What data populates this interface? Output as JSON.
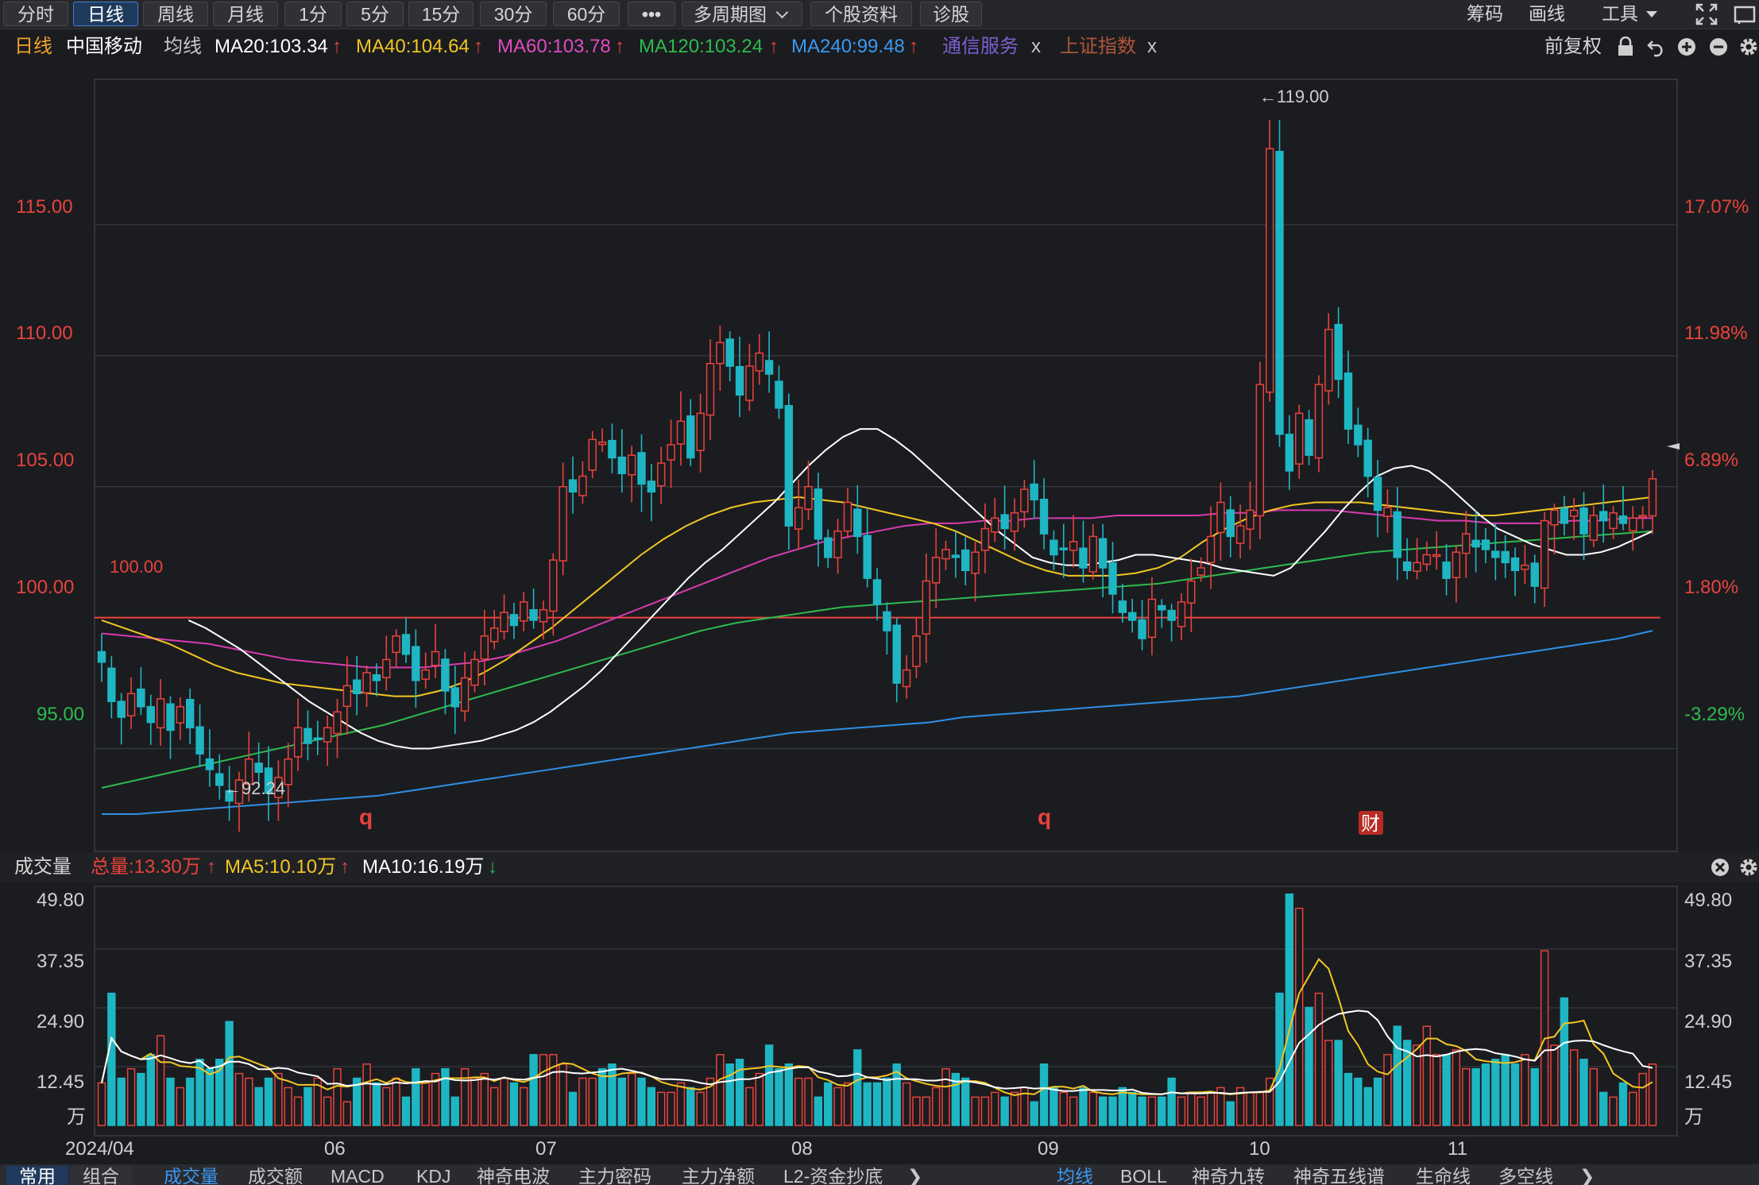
{
  "toolbar": {
    "period_tabs": [
      "分时",
      "日线",
      "周线",
      "月线",
      "1分",
      "5分",
      "15分",
      "30分",
      "60分"
    ],
    "active_tab": "日线",
    "more_label": "•••",
    "multi_period": "多周期图",
    "stock_info": "个股资料",
    "diagnose": "诊股",
    "right": {
      "chips": "筹码",
      "draw": "画线",
      "tools": "工具"
    }
  },
  "ma_bar": {
    "period": "日线",
    "stock_name": "中国移动",
    "ma_label": "均线",
    "ma20": "MA20:103.34",
    "ma40": "MA40:104.64",
    "ma60": "MA60:103.78",
    "ma120": "MA120:103.24",
    "ma240": "MA240:99.48",
    "overlay1": "通信服务",
    "overlay2": "上证指数",
    "close_mark": "x",
    "adjust": "前复权"
  },
  "colors": {
    "up": "#e8433c",
    "down": "#1fb6c4",
    "ma20": "#ffffff",
    "ma40": "#f2c623",
    "ma60": "#d83bb0",
    "ma120": "#2dbb4e",
    "ma240": "#2f8fe6",
    "grid": "#33353b"
  },
  "price_axis": {
    "left_ticks": [
      "115.00",
      "110.00",
      "105.00",
      "100.00",
      "95.00"
    ],
    "right_ticks": [
      "17.07%",
      "11.98%",
      "6.89%",
      "1.80%",
      "-3.29%"
    ],
    "ref_label": "100.00",
    "high_label": "←119.00",
    "low_label": "←92.24",
    "markers": [
      "q",
      "q",
      "财"
    ]
  },
  "volume_bar": {
    "title": "成交量",
    "total": "总量:13.30万",
    "ma5": "MA5:10.10万",
    "ma10": "MA10:16.19万",
    "ticks": [
      "49.80",
      "37.35",
      "24.90",
      "12.45"
    ],
    "unit": "万"
  },
  "date_axis": [
    "2024/04",
    "06",
    "07",
    "08",
    "09",
    "10",
    "11"
  ],
  "bottom_tabs": {
    "left": [
      "常用",
      "组合"
    ],
    "middle": [
      "成交量",
      "成交额",
      "MACD",
      "KDJ",
      "神奇电波",
      "主力密码",
      "主力净额",
      "L2-资金抄底"
    ],
    "right": [
      "均线",
      "BOLL",
      "神奇九转",
      "神奇五线谱",
      "生命线",
      "多空线"
    ]
  },
  "chart_data": {
    "type": "candlestick",
    "symbol": "中国移动",
    "period": "日线",
    "ylim": [
      91.5,
      120.0
    ],
    "x_labels": [
      "2024/04",
      "06",
      "07",
      "08",
      "09",
      "10",
      "11"
    ],
    "last_close": 105.3,
    "high": 119.0,
    "low": 92.24,
    "reference": 100.0,
    "close": [
      98.3,
      96.8,
      96.2,
      97.1,
      96.6,
      96.0,
      96.9,
      95.7,
      96.6,
      95.8,
      94.8,
      94.2,
      93.6,
      93.0,
      93.8,
      94.6,
      94.1,
      93.3,
      93.9,
      94.6,
      95.8,
      95.2,
      95.4,
      95.8,
      96.4,
      97.4,
      97.1,
      97.9,
      97.6,
      98.4,
      99.3,
      98.6,
      97.6,
      98.0,
      98.7,
      97.2,
      96.6,
      97.7,
      98.4,
      99.3,
      99.6,
      100.2,
      99.7,
      100.6,
      99.9,
      100.3,
      102.2,
      105.0,
      104.8,
      105.4,
      106.8,
      106.7,
      106.1,
      105.5,
      106.2,
      105.1,
      104.8,
      105.9,
      106.6,
      107.5,
      106.1,
      107.8,
      109.7,
      110.5,
      109.6,
      108.5,
      109.6,
      110.1,
      109.3,
      108.0,
      103.5,
      104.2,
      105.0,
      103.0,
      102.3,
      103.3,
      104.4,
      103.1,
      101.5,
      100.5,
      99.5,
      97.5,
      98.0,
      99.3,
      101.4,
      102.3,
      102.6,
      102.3,
      101.8,
      102.5,
      103.4,
      103.8,
      103.4,
      104.0,
      104.9,
      104.5,
      103.2,
      102.4,
      102.6,
      102.9,
      101.9,
      103.1,
      101.9,
      100.9,
      100.2,
      99.9,
      99.2,
      100.7,
      100.3,
      99.9,
      100.6,
      101.4,
      101.9,
      103.1,
      104.4,
      103.1,
      103.5,
      104.1,
      108.9,
      117.9,
      107.0,
      105.6,
      107.8,
      106.2,
      108.9,
      111.0,
      109.1,
      107.2,
      106.6,
      105.4,
      104.1,
      104.2,
      102.3,
      101.8,
      102.1,
      102.4,
      102.4,
      101.5,
      102.5,
      103.2,
      102.7,
      102.6,
      102.3,
      102.1,
      101.8,
      102.0,
      101.2,
      103.7,
      104.1,
      103.6,
      104.1,
      103.2,
      103.9,
      103.7,
      104.0,
      103.6,
      103.8,
      103.9,
      105.3
    ],
    "ma20": [
      99.9,
      99.6,
      99.2,
      98.8,
      98.3,
      97.8,
      97.3,
      96.8,
      96.4,
      96.0,
      95.6,
      95.3,
      95.1,
      95.0,
      95.0,
      95.1,
      95.2,
      95.3,
      95.5,
      95.7,
      96.0,
      96.4,
      96.9,
      97.4,
      98.0,
      98.7,
      99.4,
      100.1,
      100.8,
      101.5,
      102.1,
      102.6,
      103.2,
      103.8,
      104.4,
      105.1,
      105.8,
      106.4,
      106.9,
      107.2,
      107.2,
      106.8,
      106.3,
      105.7,
      105.1,
      104.5,
      103.9,
      103.3,
      102.8,
      102.3,
      102.1,
      102.0,
      102.0,
      102.1,
      102.2,
      102.4,
      102.4,
      102.3,
      102.2,
      102.1,
      101.9,
      101.8,
      101.7,
      101.6,
      101.9,
      102.6,
      103.3,
      104.1,
      104.8,
      105.4,
      105.7,
      105.8,
      105.6,
      105.1,
      104.5,
      103.9,
      103.4,
      103.1,
      102.8,
      102.6,
      102.4,
      102.4,
      102.5,
      102.7,
      103.0,
      103.3
    ],
    "ma40": [
      99.9,
      99.6,
      99.3,
      99.0,
      98.6,
      98.2,
      97.9,
      97.7,
      97.5,
      97.4,
      97.3,
      97.2,
      97.1,
      97.0,
      97.0,
      97.2,
      97.5,
      97.9,
      98.4,
      99.0,
      99.6,
      100.3,
      101.0,
      101.7,
      102.4,
      103.0,
      103.5,
      103.9,
      104.2,
      104.4,
      104.5,
      104.6,
      104.5,
      104.4,
      104.2,
      104.0,
      103.8,
      103.6,
      103.3,
      102.9,
      102.5,
      102.1,
      101.8,
      101.6,
      101.6,
      101.6,
      101.7,
      101.9,
      102.3,
      102.9,
      103.4,
      103.8,
      104.1,
      104.3,
      104.4,
      104.4,
      104.4,
      104.3,
      104.2,
      104.1,
      104.0,
      103.9,
      103.9,
      104.0,
      104.1,
      104.2,
      104.3,
      104.4,
      104.5,
      104.6
    ],
    "ma60": [
      99.4,
      99.3,
      99.2,
      99.1,
      99.0,
      98.8,
      98.6,
      98.4,
      98.3,
      98.2,
      98.1,
      98.1,
      98.1,
      98.2,
      98.3,
      98.5,
      98.8,
      99.1,
      99.5,
      99.9,
      100.3,
      100.7,
      101.1,
      101.5,
      101.9,
      102.3,
      102.6,
      102.9,
      103.1,
      103.3,
      103.5,
      103.6,
      103.6,
      103.7,
      103.7,
      103.8,
      103.8,
      103.8,
      103.9,
      103.9,
      103.9,
      103.9,
      104.0,
      104.0,
      104.1,
      104.1,
      104.1,
      104.0,
      103.9,
      103.8,
      103.7,
      103.7,
      103.6,
      103.6,
      103.6,
      103.7,
      103.7,
      103.8,
      103.8
    ],
    "ma120": [
      93.5,
      93.8,
      94.1,
      94.4,
      94.7,
      95.0,
      95.3,
      95.6,
      95.9,
      96.3,
      96.7,
      97.1,
      97.5,
      97.9,
      98.3,
      98.7,
      99.1,
      99.5,
      99.8,
      100.0,
      100.2,
      100.4,
      100.5,
      100.6,
      100.7,
      100.8,
      100.9,
      101.0,
      101.1,
      101.2,
      101.3,
      101.5,
      101.7,
      101.9,
      102.1,
      102.3,
      102.5,
      102.6,
      102.7,
      102.8,
      102.9,
      103.0,
      103.1,
      103.2,
      103.3
    ],
    "ma240": [
      92.5,
      92.5,
      92.6,
      92.7,
      92.8,
      92.9,
      93.0,
      93.1,
      93.2,
      93.4,
      93.6,
      93.8,
      94.0,
      94.2,
      94.4,
      94.6,
      94.8,
      95.0,
      95.2,
      95.4,
      95.6,
      95.7,
      95.8,
      95.9,
      96.0,
      96.2,
      96.3,
      96.4,
      96.5,
      96.6,
      96.7,
      96.8,
      96.9,
      97.0,
      97.2,
      97.4,
      97.6,
      97.8,
      98.0,
      98.2,
      98.4,
      98.6,
      98.8,
      99.0,
      99.2,
      99.5
    ],
    "volume_ylim": [
      0,
      49.8
    ],
    "volume": [
      9,
      28,
      10,
      12,
      11,
      15,
      19,
      10,
      8,
      10,
      14,
      12,
      14,
      22,
      11,
      10,
      8,
      10,
      11,
      8,
      6,
      8,
      10,
      6,
      12,
      5,
      10,
      13,
      9,
      8,
      10,
      6,
      12,
      9,
      11,
      12,
      6,
      12,
      10,
      11,
      8,
      10,
      9,
      8,
      15,
      15,
      15,
      13,
      7,
      10,
      10,
      12,
      13,
      10,
      11,
      10,
      8,
      7,
      7,
      9,
      8,
      7,
      10,
      15,
      13,
      14,
      8,
      11,
      17,
      12,
      13,
      10,
      10,
      6,
      9,
      8,
      9,
      16,
      9,
      9,
      10,
      13,
      9,
      6,
      6,
      8,
      12,
      11,
      10,
      6,
      6,
      7,
      6,
      7,
      8,
      5,
      13,
      8,
      7,
      6,
      8,
      7,
      6,
      6,
      8,
      7,
      6,
      6,
      6,
      10,
      6,
      7,
      6,
      7,
      8,
      5,
      8,
      7,
      7,
      10,
      28,
      49,
      46,
      25,
      28,
      18,
      18,
      11,
      10,
      8,
      10,
      15,
      21,
      18,
      17,
      21,
      15,
      15,
      16,
      12,
      12,
      13,
      14,
      15,
      13,
      15,
      12,
      37,
      17,
      27,
      16,
      14,
      12,
      7,
      6,
      9,
      7,
      11,
      13
    ]
  }
}
